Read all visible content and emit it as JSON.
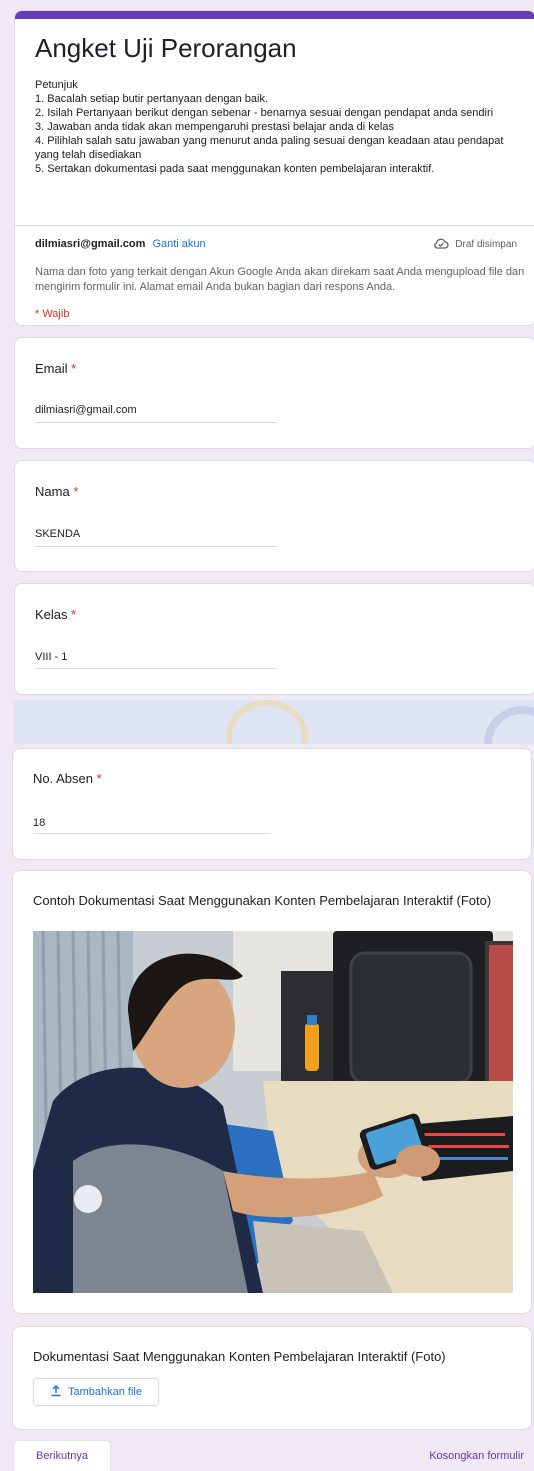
{
  "form": {
    "title": "Angket Uji Perorangan",
    "instructions": [
      "Petunjuk",
      "1. Bacalah setiap butir pertanyaan dengan baik.",
      "2. Isilah Pertanyaan berikut dengan sebenar - benarnya sesuai dengan pendapat anda sendiri",
      "3. Jawaban anda tidak akan mempengaruhi prestasi belajar anda di kelas",
      "4. Pilihlah salah satu jawaban yang menurut anda paling sesuai dengan keadaan atau pendapat yang telah disediakan",
      "5. Sertakan dokumentasi pada saat menggunakan konten pembelajaran interaktif."
    ],
    "account_email": "dilmiasri@gmail.com",
    "switch_account": "Ganti akun",
    "draft_status": "Draf disimpan",
    "notice": "Nama dan foto yang terkait dengan Akun Google Anda akan direkam saat Anda mengupload file dan mengirim formulir ini. Alamat email Anda bukan bagian dari respons Anda.",
    "required_note": "* Wajib"
  },
  "questions": {
    "email": {
      "label": "Email",
      "required": "*",
      "value": "dilmiasri@gmail.com"
    },
    "nama": {
      "label": "Nama",
      "required": "*",
      "value": "SKENDA"
    },
    "kelas": {
      "label": "Kelas",
      "required": "*",
      "value": "VIII - 1"
    },
    "absen": {
      "label": "No. Absen",
      "required": "*",
      "value": "18"
    }
  },
  "example_section": {
    "title": "Contoh Dokumentasi Saat Menggunakan Konten Pembelajaran Interaktif (Foto)"
  },
  "upload_section": {
    "title": "Dokumentasi Saat Menggunakan Konten Pembelajaran Interaktif (Foto)",
    "button": "Tambahkan file"
  },
  "footer": {
    "next": "Berikutnya",
    "clear": "Kosongkan formulir"
  },
  "colors": {
    "accent": "#673ab7",
    "link": "#1a73e8",
    "required": "#d93025",
    "background": "#eee9f5"
  },
  "icons": {
    "draft": "cloud-check-icon",
    "upload": "upload-icon"
  }
}
